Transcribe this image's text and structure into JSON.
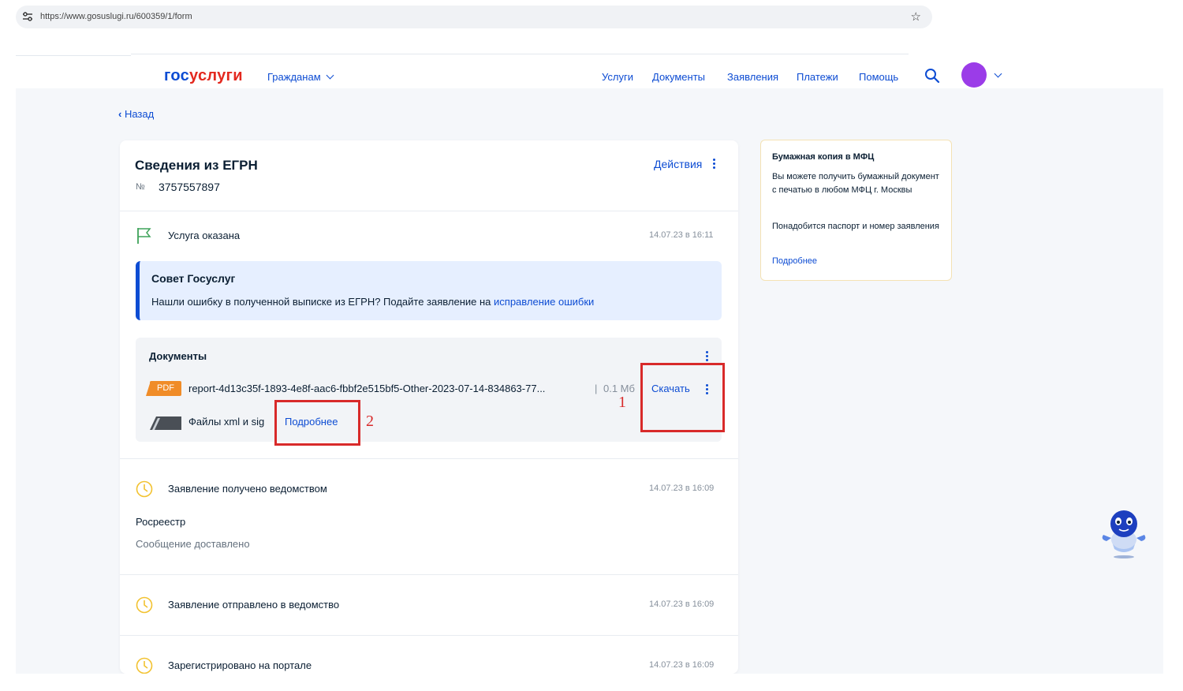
{
  "browser": {
    "url": "https://www.gosuslugi.ru/600359/1/form"
  },
  "header": {
    "logo_part1": "гос",
    "logo_part2": "услуги",
    "citizens": "Гражданам",
    "nav": [
      "Услуги",
      "Документы",
      "Заявления",
      "Платежи",
      "Помощь"
    ]
  },
  "back_label": "Назад",
  "application": {
    "title": "Сведения из ЕГРН",
    "number_label": "№",
    "number": "3757557897",
    "actions_label": "Действия"
  },
  "service_status": {
    "text": "Услуга оказана",
    "date": "14.07.23 в 16:11"
  },
  "advice": {
    "title": "Совет Госуслуг",
    "text": "Нашли ошибку в полученной выписке из ЕГРН? Подайте заявление на ",
    "link": "исправление ошибки"
  },
  "documents": {
    "title": "Документы",
    "file": {
      "type": "PDF",
      "name": "report-4d13c35f-1893-4e8f-aac6-fbbf2e515bf5-Other-2023-07-14-834863-77...",
      "separator": "|",
      "size": "0.1 Мб",
      "download_label": "Скачать"
    },
    "xml": {
      "label": "Файлы xml и sig",
      "more_label": "Подробнее"
    }
  },
  "annotations": {
    "mark1": "1",
    "mark2": "2",
    "color": "#d82a2a"
  },
  "timeline": [
    {
      "text": "Заявление получено ведомством",
      "date": "14.07.23 в 16:09",
      "agency": "Росреестр",
      "note": "Сообщение доставлено"
    },
    {
      "text": "Заявление отправлено в ведомство",
      "date": "14.07.23 в 16:09"
    },
    {
      "text": "Зарегистрировано на портале",
      "date": "14.07.23 в 16:09"
    }
  ],
  "side_info": {
    "title": "Бумажная копия в МФЦ",
    "p1": "Вы можете получить бумажный документ с печатью в любом МФЦ г. Москвы",
    "p2": "Понадобится паспорт и номер заявления",
    "link": "Подробнее"
  },
  "colors": {
    "accent": "#0d4cd3",
    "brand_red": "#e3281e",
    "avatar": "#9b3ce8",
    "pdf": "#f08c28",
    "clock": "#f2c230",
    "flag": "#3fa35a"
  },
  "icons": [
    "tune-icon",
    "star-icon",
    "search-icon",
    "chevron-down-icon",
    "chevron-left-icon",
    "kebab-icon",
    "flag-icon",
    "clock-icon",
    "pdf-icon",
    "file-archive-icon",
    "robot-assistant-icon"
  ]
}
